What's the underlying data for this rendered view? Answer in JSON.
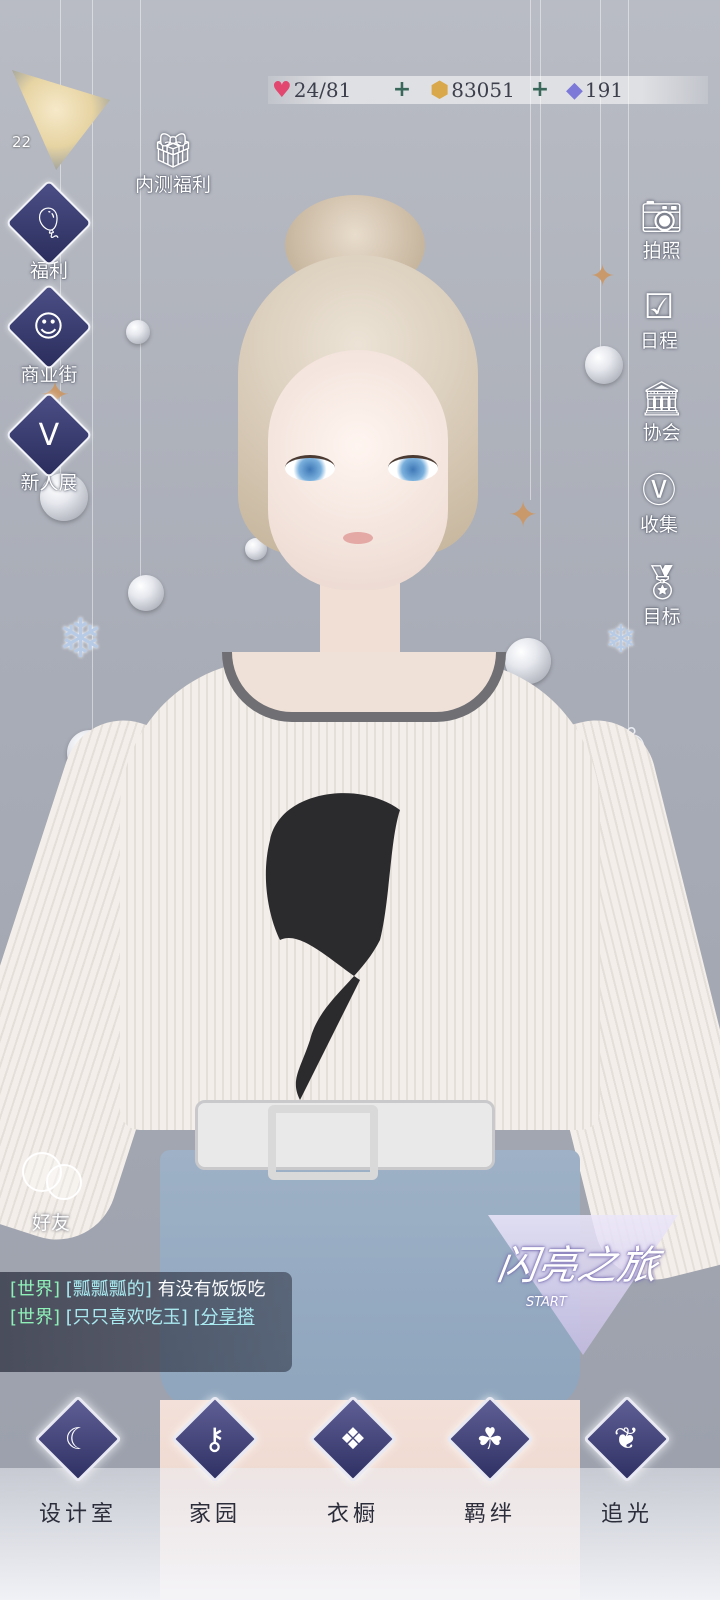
{
  "player": {
    "level": "22"
  },
  "resources": {
    "stamina": "24/81",
    "gold": "83051",
    "diamonds": "191"
  },
  "left_menu": {
    "beta_gift": {
      "label": "内测福利",
      "icon": "gift-icon"
    },
    "welfare": {
      "label": "福利",
      "icon": "balloon-icon"
    },
    "shop_street": {
      "label": "商业街",
      "icon": "shopping-bag-icon"
    },
    "newcomer_show": {
      "label": "新人展",
      "icon": "v-crown-icon"
    }
  },
  "right_menu": {
    "photo": {
      "label": "拍照",
      "icon": "camera-icon"
    },
    "schedule": {
      "label": "日程",
      "icon": "calendar-check-icon"
    },
    "guild": {
      "label": "协会",
      "icon": "building-icon"
    },
    "collection": {
      "label": "收集",
      "icon": "v-badge-icon"
    },
    "goals": {
      "label": "目标",
      "icon": "medal-icon"
    }
  },
  "friends": {
    "label": "好友",
    "icon": "friends-bubbles-icon"
  },
  "chat": {
    "messages": [
      {
        "channel": "[世界]",
        "nick": "[瓢瓢瓢的]",
        "text": "有没有饭饭吃"
      },
      {
        "channel": "[世界]",
        "nick": "[只只喜欢吃玉]",
        "link": "[分享搭"
      }
    ]
  },
  "journey_banner": {
    "title": "闪亮之旅",
    "sub": "START"
  },
  "bottom_tabs": [
    {
      "label": "设计室",
      "icon": "moon-needle-icon"
    },
    {
      "label": "家园",
      "icon": "key-icon"
    },
    {
      "label": "衣橱",
      "icon": "crystal-icon"
    },
    {
      "label": "羁绊",
      "icon": "clover-icon"
    },
    {
      "label": "追光",
      "icon": "butterfly-icon"
    }
  ],
  "colors": {
    "background": "#a9adb7",
    "chat_channel": "#8ff0b8",
    "chat_nick": "#a9e9f0",
    "resource_text": "#3d3f4d",
    "plus_green": "#39675a"
  }
}
